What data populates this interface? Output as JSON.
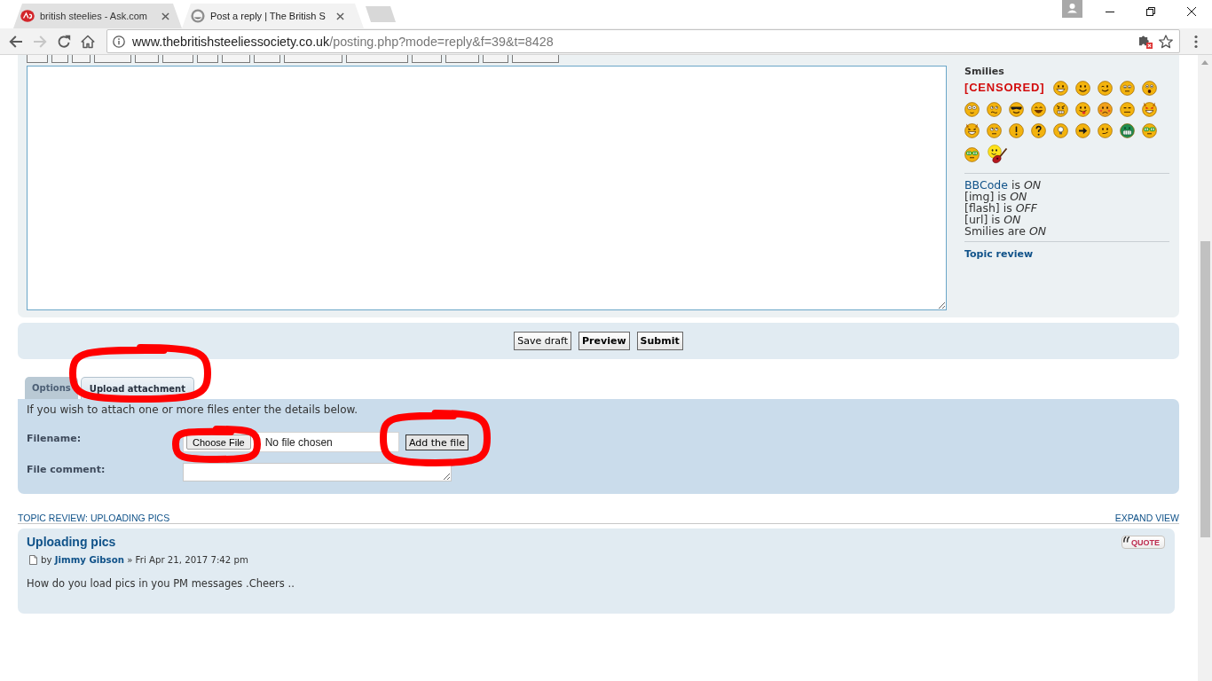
{
  "browser": {
    "tabs": [
      {
        "title": "british steelies - Ask.com",
        "selected": false
      },
      {
        "title": "Post a reply | The British S",
        "selected": true
      }
    ],
    "nav_buttons": [
      {
        "kind": "back",
        "disabled": false
      },
      {
        "kind": "forward",
        "disabled": true
      },
      {
        "kind": "reload",
        "disabled": false
      },
      {
        "kind": "home",
        "disabled": false
      }
    ],
    "address": {
      "host": "www.thebritishsteeliessociety.co.uk",
      "path": "/posting.php?mode=reply&f=39&t=8428"
    }
  },
  "editor": {
    "smilies_title": "Smilies",
    "smilies": [
      {
        "kind": "text",
        "label": "[CENSORED]"
      },
      {
        "kind": "grin"
      },
      {
        "kind": "smile"
      },
      {
        "kind": "wink"
      },
      {
        "kind": "sleepy"
      },
      {
        "kind": "shock"
      },
      {
        "kind": "eek"
      },
      {
        "kind": "confused"
      },
      {
        "kind": "cool"
      },
      {
        "kind": "laugh"
      },
      {
        "kind": "mad"
      },
      {
        "kind": "razz"
      },
      {
        "kind": "sad"
      },
      {
        "kind": "neutral"
      },
      {
        "kind": "devil"
      },
      {
        "kind": "evil"
      },
      {
        "kind": "rolleyes"
      },
      {
        "kind": "exclaim"
      },
      {
        "kind": "question"
      },
      {
        "kind": "idea"
      },
      {
        "kind": "arrow"
      },
      {
        "kind": "smirk"
      },
      {
        "kind": "green"
      },
      {
        "kind": "geek"
      },
      {
        "kind": "geek"
      },
      {
        "kind": "guitar"
      }
    ],
    "status_lines": [
      {
        "link": "BBCode",
        "text": "is *ON*"
      },
      {
        "text": "[img] is *ON*"
      },
      {
        "text": "[flash] is *OFF*"
      },
      {
        "text": "[url] is *ON*"
      },
      {
        "text": "Smilies are *ON*"
      }
    ],
    "topic_review_link": "Topic review"
  },
  "submit_buttons": [
    {
      "label": "Save draft",
      "kind": "save"
    },
    {
      "label": "Preview",
      "kind": "preview"
    },
    {
      "label": "Submit",
      "kind": "submit"
    }
  ],
  "attachment_tabs": [
    {
      "label": "Options",
      "selected": false,
      "circled": false
    },
    {
      "label": "Upload attachment",
      "selected": true,
      "circled": true
    }
  ],
  "upload": {
    "intro": "If you wish to attach one or more files enter the details below.",
    "fields": [
      {
        "kind": "file",
        "label": "Filename:",
        "button": "Choose File",
        "status": "No file chosen",
        "button_circled": true,
        "action": "Add the file",
        "action_circled": true
      },
      {
        "kind": "comment",
        "label": "File comment:"
      }
    ]
  },
  "topic_review": {
    "heading": "TOPIC REVIEW: UPLOADING PICS",
    "expand": "EXPAND VIEW",
    "posts": [
      {
        "title": "Uploading pics",
        "quote": "QUOTE",
        "by": "by",
        "author": "Jimmy Gibson",
        "date": "» Fri Apr 21, 2017 7:42 pm",
        "body": "How do you load pics in you PM messages .Cheers .."
      }
    ]
  }
}
